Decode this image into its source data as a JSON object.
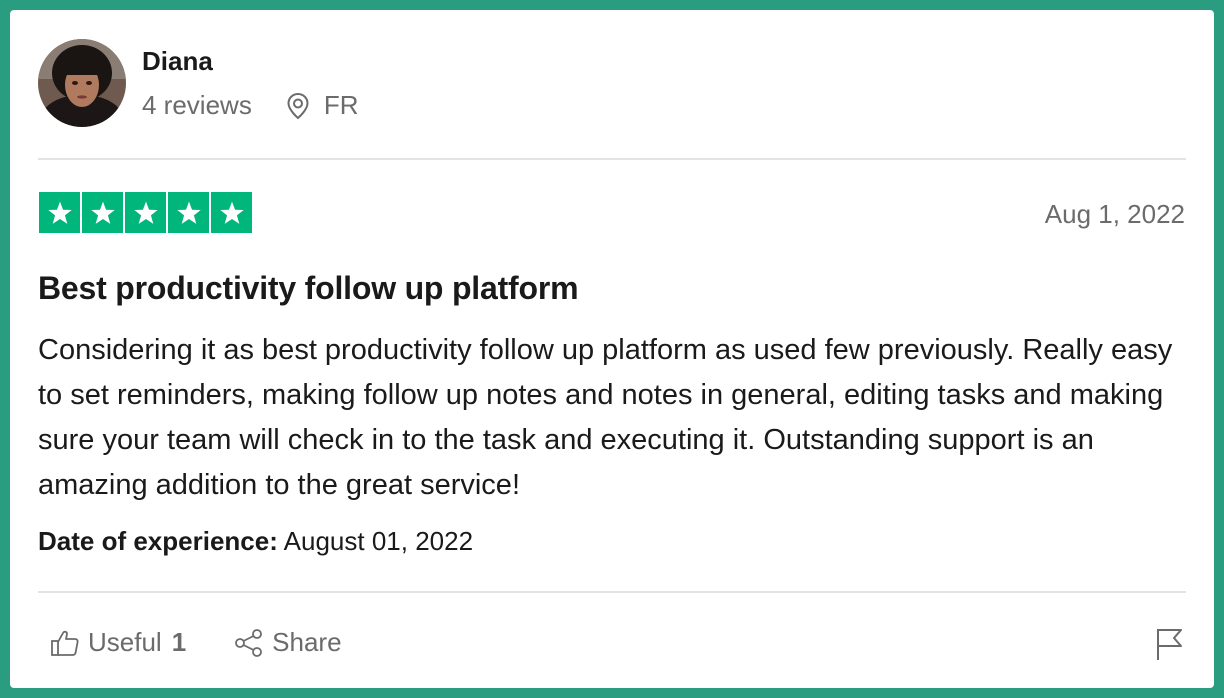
{
  "reviewer": {
    "name": "Diana",
    "reviews_count": "4 reviews",
    "country": "FR"
  },
  "review": {
    "rating": 5,
    "rating_max": 5,
    "date": "Aug 1, 2022",
    "title": "Best productivity follow up platform",
    "body": "Considering it as best productivity follow up platform as used few previously. Really easy to set reminders, making follow up notes and notes in general, editing tasks and making sure your team will check in to the task and executing it. Outstanding support is an amazing addition to the great service!",
    "experience_label": "Date of experience:",
    "experience_date": "August 01, 2022"
  },
  "actions": {
    "useful_label": "Useful",
    "useful_count": "1",
    "share_label": "Share"
  },
  "icons": {
    "location": "location-pin-icon",
    "star": "star-icon",
    "useful": "thumbs-up-icon",
    "share": "share-icon",
    "report": "flag-icon"
  },
  "colors": {
    "frame": "#2a9c80",
    "star_bg": "#00b67a"
  }
}
